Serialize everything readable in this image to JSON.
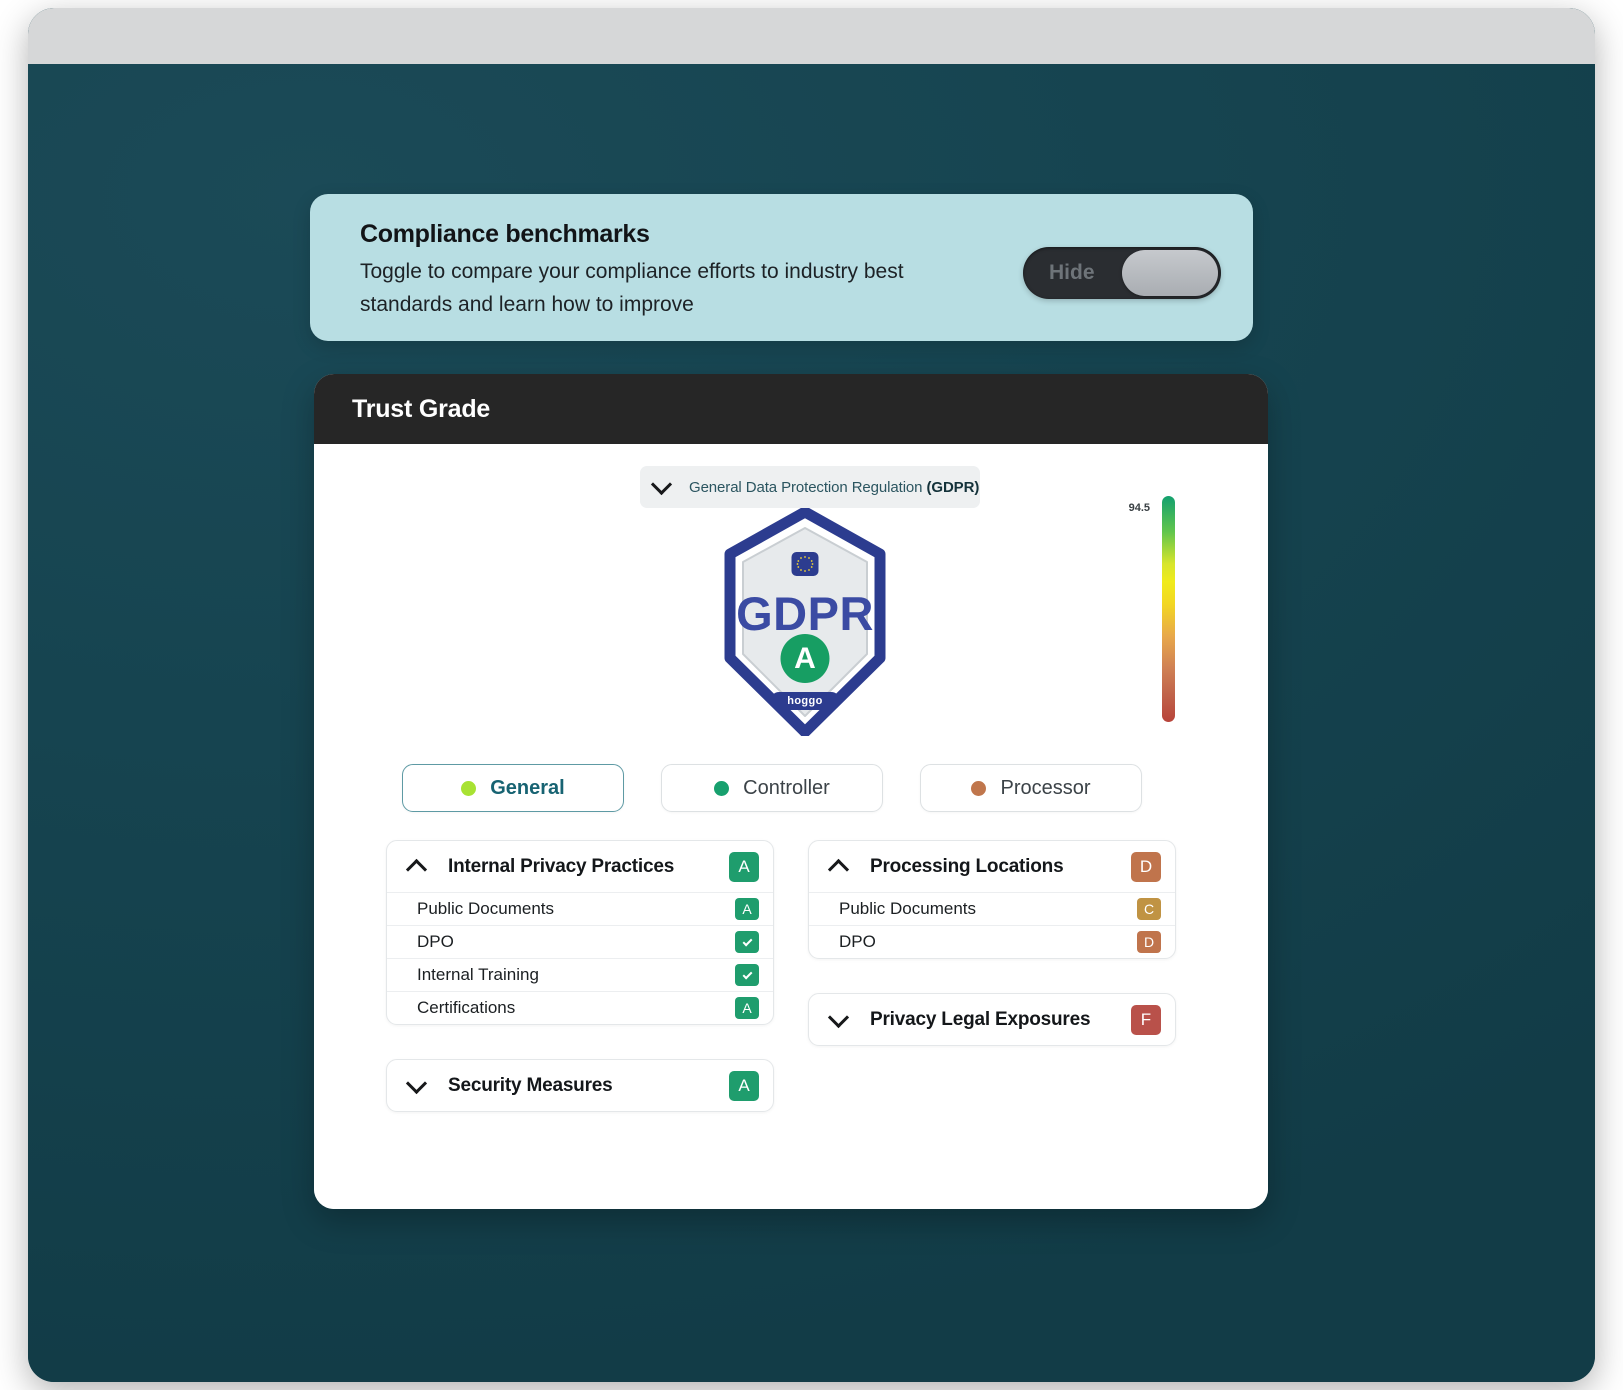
{
  "banner": {
    "title": "Compliance benchmarks",
    "subtitle": "Toggle to compare your compliance efforts to industry best standards and learn how to improve",
    "toggle_label": "Hide"
  },
  "card": {
    "header_title": "Trust Grade",
    "regulation": {
      "name": "General Data Protection Regulation ",
      "abbr": "(GDPR)"
    },
    "badge": {
      "name": "GDPR",
      "grade": "A",
      "brand": "hoggo",
      "eu_stars": "⭐"
    },
    "score": {
      "value": "94.5",
      "gradient_top": "#13a06f",
      "gradient_mid": "#f0eb1b",
      "gradient_bottom": "#b8433a"
    },
    "tabs": [
      {
        "label": "General",
        "dot_color": "#a8e233",
        "active": true
      },
      {
        "label": "Controller",
        "dot_color": "#17a06e",
        "active": false
      },
      {
        "label": "Processor",
        "dot_color": "#c0764c",
        "active": false
      }
    ],
    "panels_left": [
      {
        "title": "Internal Privacy Practices",
        "grade": "A",
        "grade_kind": "A",
        "expanded": true,
        "rows": [
          {
            "label": "Public Documents",
            "grade": "A",
            "grade_kind": "A"
          },
          {
            "label": "DPO",
            "grade": "",
            "grade_kind": "check"
          },
          {
            "label": "Internal Training",
            "grade": "",
            "grade_kind": "check"
          },
          {
            "label": "Certifications",
            "grade": "A",
            "grade_kind": "A"
          }
        ]
      },
      {
        "title": "Security Measures",
        "grade": "A",
        "grade_kind": "A",
        "expanded": false,
        "rows": []
      }
    ],
    "panels_right": [
      {
        "title": "Processing Locations",
        "grade": "D",
        "grade_kind": "D",
        "expanded": true,
        "rows": [
          {
            "label": "Public Documents",
            "grade": "C",
            "grade_kind": "C"
          },
          {
            "label": "DPO",
            "grade": "D",
            "grade_kind": "D"
          }
        ]
      },
      {
        "title": "Privacy Legal Exposures",
        "grade": "F",
        "grade_kind": "F",
        "expanded": false,
        "rows": []
      }
    ]
  },
  "theme": {
    "background": "#164450",
    "banner_bg": "#b8dee3",
    "card_header_bg": "#262626",
    "accent_teal": "#176372"
  }
}
